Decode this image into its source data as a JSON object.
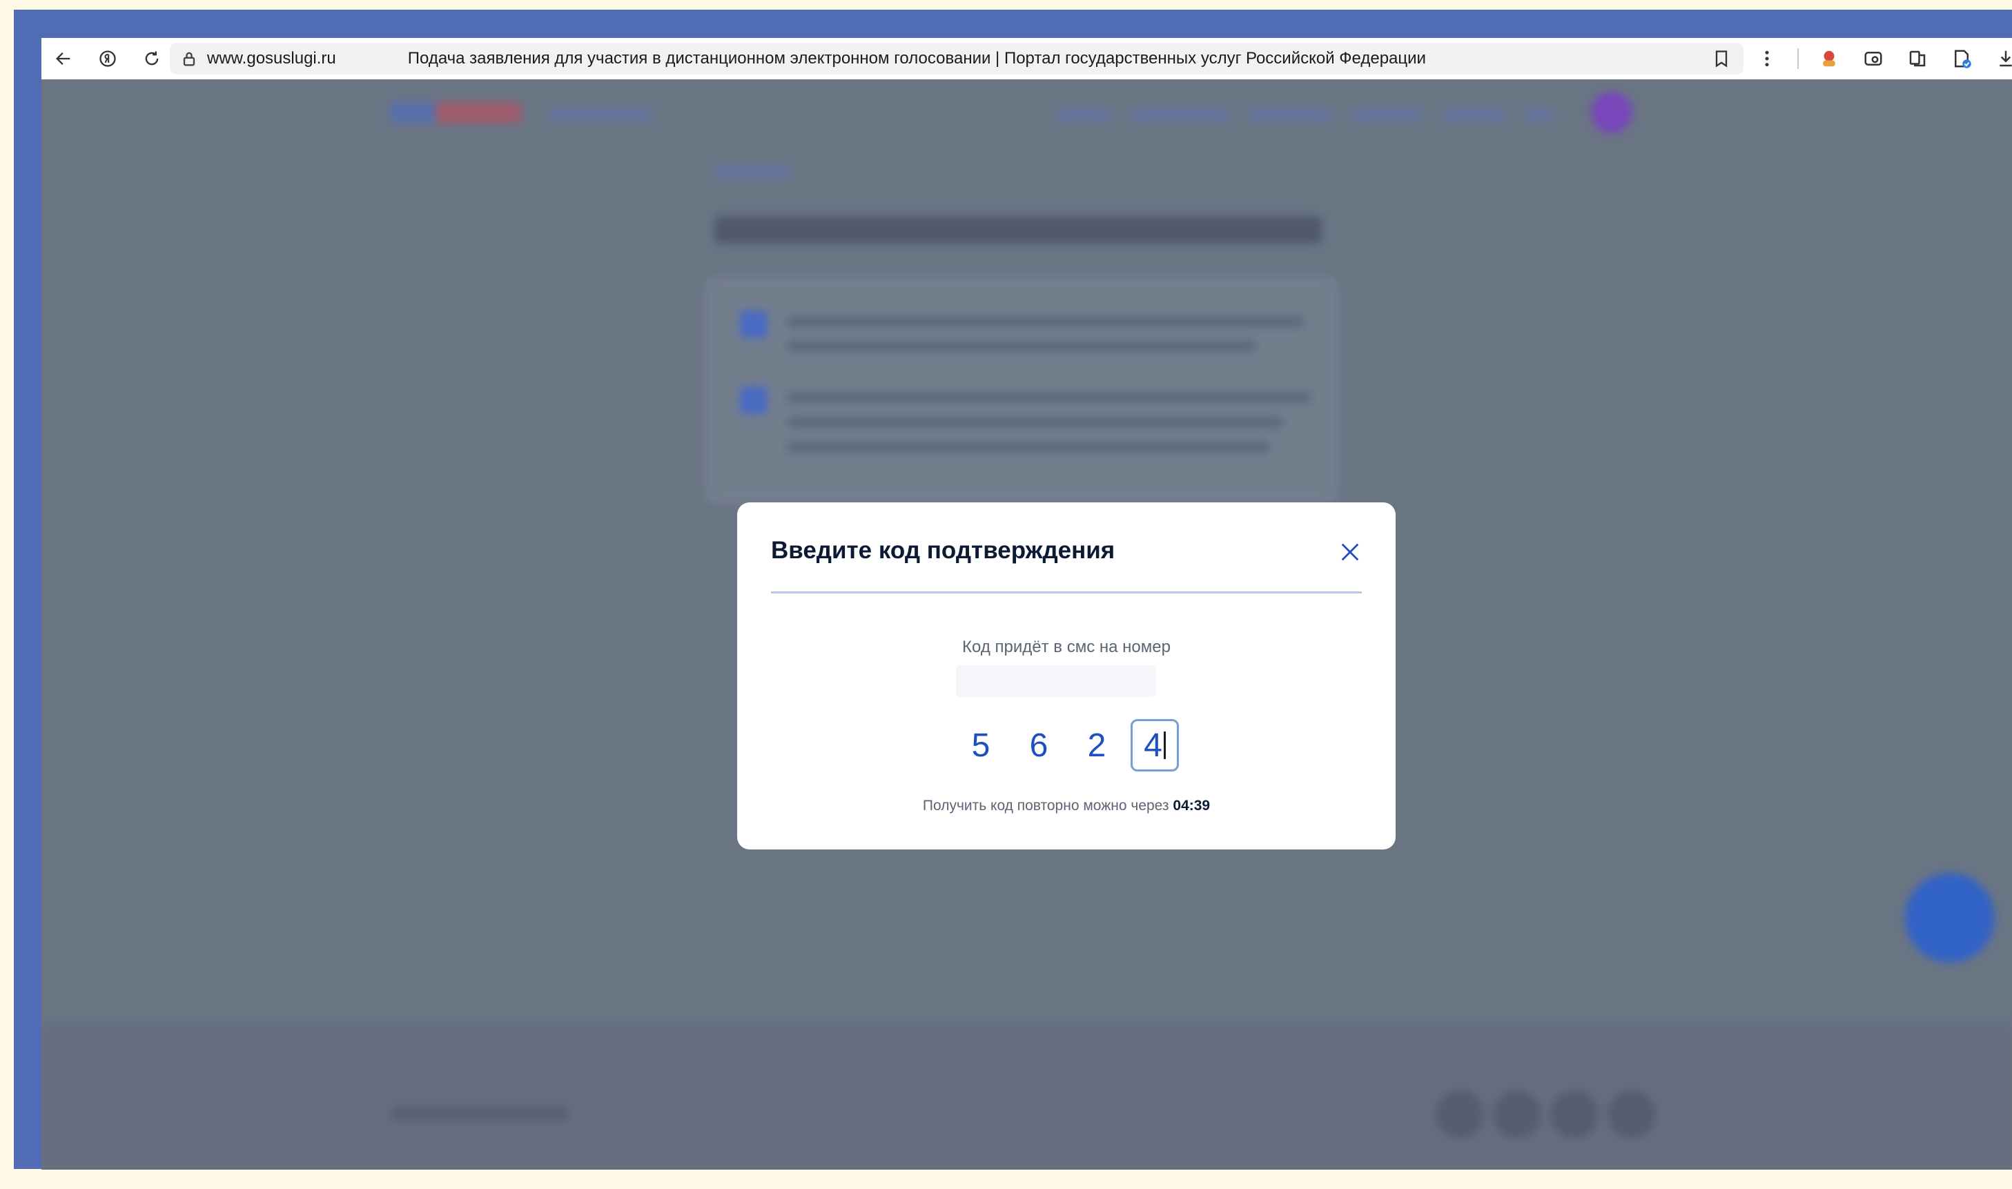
{
  "browser": {
    "domain": "www.gosuslugi.ru",
    "page_title": "Подача заявления для участия в дистанционном электронном голосовании | Портал государственных услуг Российской Федерации"
  },
  "modal": {
    "title": "Введите код подтверждения",
    "sms_label": "Код придёт в смс на номер",
    "code_digits": [
      "5",
      "6",
      "2",
      "4"
    ],
    "resend_text": "Получить код повторно можно через",
    "resend_timer": "04:39"
  },
  "colors": {
    "accent": "#1d4fc1",
    "overlay": "#6a7584",
    "frame": "#506cb4"
  }
}
